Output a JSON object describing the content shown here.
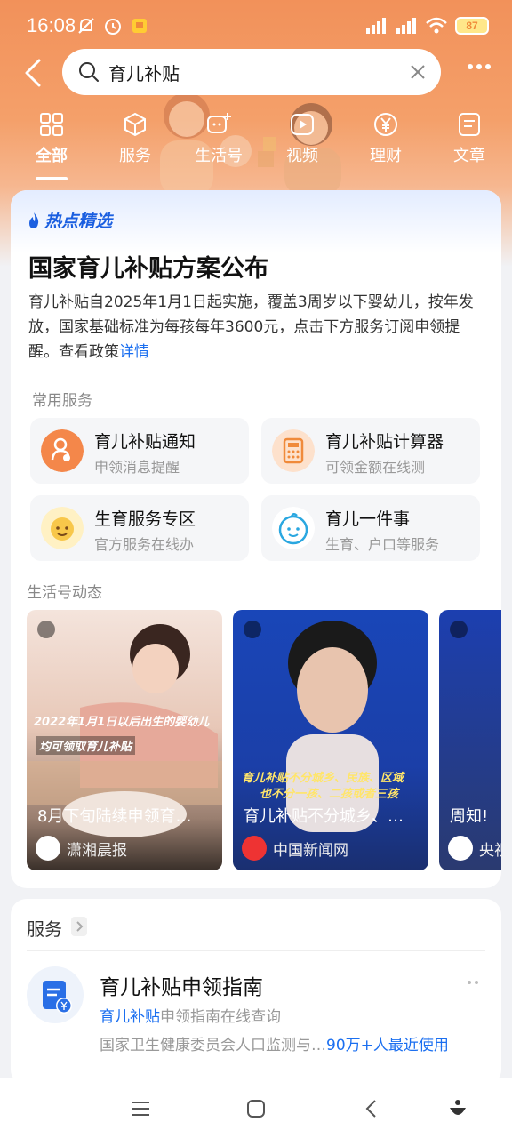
{
  "status": {
    "time": "16:08",
    "battery": "87"
  },
  "search": {
    "query": "育儿补贴"
  },
  "tabs": [
    {
      "label": "全部",
      "icon": "grid-icon"
    },
    {
      "label": "服务",
      "icon": "cube-icon"
    },
    {
      "label": "生活号",
      "icon": "chat-plus-icon"
    },
    {
      "label": "视频",
      "icon": "play-icon"
    },
    {
      "label": "理财",
      "icon": "yen-icon"
    },
    {
      "label": "文章",
      "icon": "document-icon"
    }
  ],
  "hot": {
    "tag": "热点精选",
    "title": "国家育儿补贴方案公布",
    "desc": "育儿补贴自2025年1月1日起实施，覆盖3周岁以下婴幼儿，按年发放，国家基础标准为每孩每年3600元，点击下方服务订阅申领提醒。查看政策",
    "link": "详情"
  },
  "common_services": {
    "label": "常用服务",
    "items": [
      {
        "title": "育儿补贴通知",
        "sub": "申领消息提醒"
      },
      {
        "title": "育儿补贴计算器",
        "sub": "可领金额在线测"
      },
      {
        "title": "生育服务专区",
        "sub": "官方服务在线办"
      },
      {
        "title": "育儿一件事",
        "sub": "生育、户口等服务"
      }
    ]
  },
  "life": {
    "label": "生活号动态",
    "videos": [
      {
        "title": "8月下旬陆续申领育…",
        "source": "潇湘晨报",
        "cap1": "2022年1月1日以后出生的婴幼儿",
        "cap2": "均可领取育儿补贴"
      },
      {
        "title": "育儿补贴不分城乡、…",
        "source": "中国新闻网",
        "cap1": "育儿补贴不分城乡、民族、区域",
        "cap2": "也不分一孩、二孩或者三孩"
      },
      {
        "title": "周知!",
        "source": "央视"
      }
    ]
  },
  "services": {
    "header": "服务",
    "guide": {
      "title": "育儿补贴申领指南",
      "sub_hl": "育儿补贴",
      "sub_rest": "申领指南在线查询",
      "meta": "国家卫生健康委员会人口监测与…",
      "meta_hl": "90万+人最近使用"
    }
  },
  "colors": {
    "accent_orange": "#f2915a",
    "link_blue": "#1b6ff0"
  }
}
